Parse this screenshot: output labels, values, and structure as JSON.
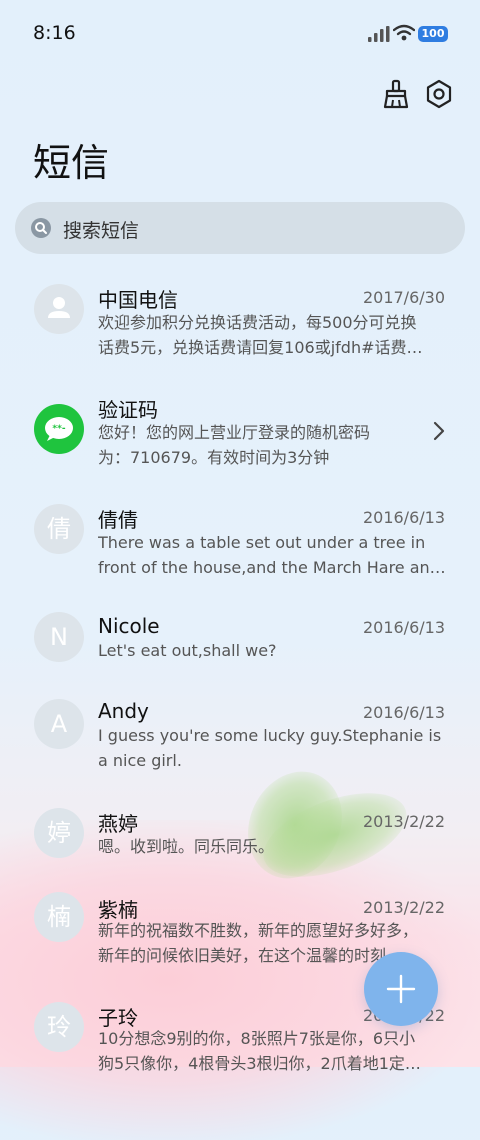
{
  "status": {
    "time": "8:16",
    "battery": "100"
  },
  "header": {
    "title": "短信"
  },
  "search": {
    "placeholder": "搜索短信"
  },
  "messages": [
    {
      "name": "中国电信",
      "date": "2017/6/30",
      "line1": "欢迎参加积分兑换话费活动，每500分可兑换",
      "line2": "话费5元，兑换话费请回复106或jfdh#话费…",
      "avatar": ""
    },
    {
      "name": "验证码",
      "date": "",
      "line1": "您好！您的网上营业厅登录的随机密码",
      "line2": "为：710679。有效时间为3分钟",
      "avatar": "**-"
    },
    {
      "name": "倩倩",
      "date": "2016/6/13",
      "line1": "There was a table set out under a tree in",
      "line2": "front of the house,and the March Hare an…",
      "avatar": "倩"
    },
    {
      "name": "Nicole",
      "date": "2016/6/13",
      "line1": "Let's eat out,shall we?",
      "line2": "",
      "avatar": "N"
    },
    {
      "name": "Andy",
      "date": "2016/6/13",
      "line1": "I guess you're some lucky guy.Stephanie is",
      "line2": "a nice girl.",
      "avatar": "A"
    },
    {
      "name": "燕婷",
      "date": "2013/2/22",
      "line1": "嗯。收到啦。同乐同乐。",
      "line2": "",
      "avatar": "婷"
    },
    {
      "name": "紫楠",
      "date": "2013/2/22",
      "line1": "新年的祝福数不胜数，新年的愿望好多好多，",
      "line2": "新年的问候依旧美好，在这个温馨的时刻…",
      "avatar": "楠"
    },
    {
      "name": "子玲",
      "date": "2013/2/22",
      "line1": "10分想念9别的你，8张照片7张是你，6只小",
      "line2": "狗5只像你，4根骨头3根归你，2爪着地1定…",
      "avatar": "玲"
    }
  ],
  "colors": {
    "accent": "#7fb4ec",
    "verification": "#1fc43e"
  }
}
